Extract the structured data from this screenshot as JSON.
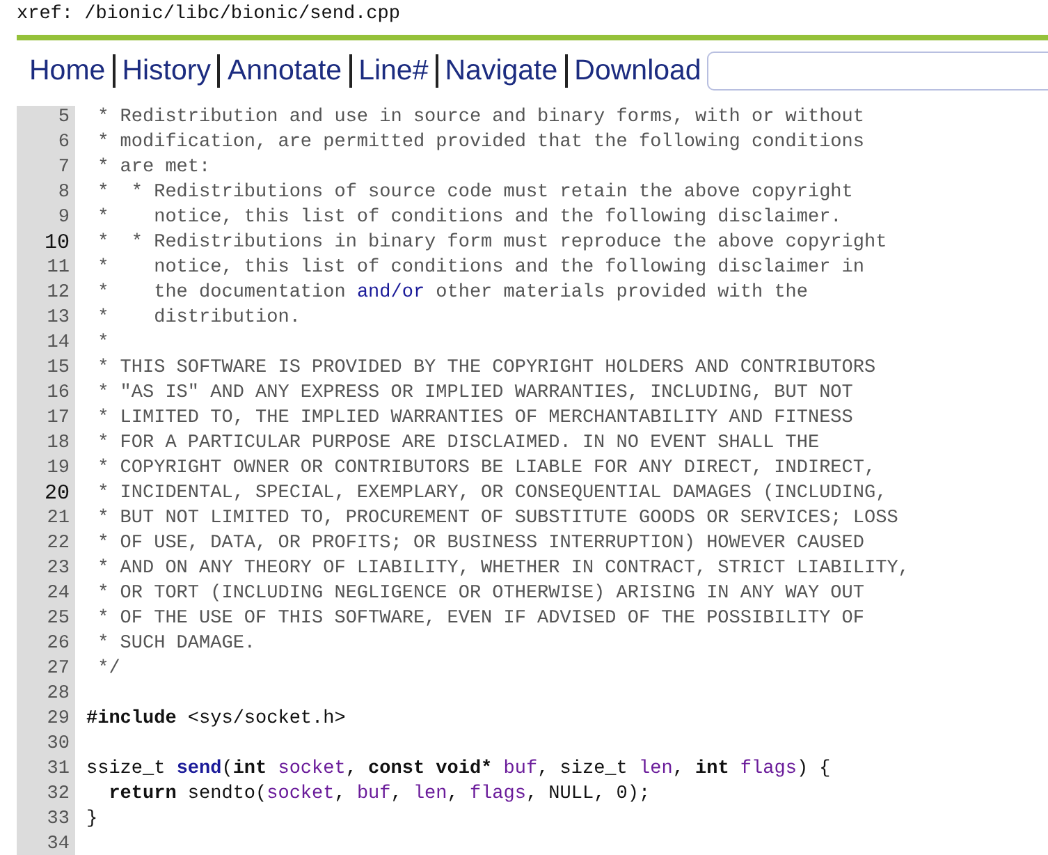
{
  "title": "xref: /bionic/libc/bionic/send.cpp",
  "nav": [
    {
      "label": "Home"
    },
    {
      "label": "History"
    },
    {
      "label": "Annotate"
    },
    {
      "label": "Line#"
    },
    {
      "label": "Navigate"
    },
    {
      "label": "Download"
    }
  ],
  "lines": [
    {
      "number": "5",
      "bold": false,
      "tokens": [
        {
          "kind": "comment",
          "text": " * Redistribution and use in source and binary forms, with or without"
        }
      ]
    },
    {
      "number": "6",
      "bold": false,
      "tokens": [
        {
          "kind": "comment",
          "text": " * modification, are permitted provided that the following conditions"
        }
      ]
    },
    {
      "number": "7",
      "bold": false,
      "tokens": [
        {
          "kind": "comment",
          "text": " * are met:"
        }
      ]
    },
    {
      "number": "8",
      "bold": false,
      "tokens": [
        {
          "kind": "comment",
          "text": " *  * Redistributions of source code must retain the above copyright"
        }
      ]
    },
    {
      "number": "9",
      "bold": false,
      "tokens": [
        {
          "kind": "comment",
          "text": " *    notice, this list of conditions and the following disclaimer."
        }
      ]
    },
    {
      "number": "10",
      "bold": true,
      "tokens": [
        {
          "kind": "comment",
          "text": " *  * Redistributions in binary form must reproduce the above copyright"
        }
      ]
    },
    {
      "number": "11",
      "bold": false,
      "tokens": [
        {
          "kind": "comment",
          "text": " *    notice, this list of conditions and the following disclaimer in"
        }
      ]
    },
    {
      "number": "12",
      "bold": false,
      "tokens": [
        {
          "kind": "comment",
          "text": " *    the documentation "
        },
        {
          "kind": "link",
          "text": "and/or"
        },
        {
          "kind": "comment",
          "text": " other materials provided with the"
        }
      ]
    },
    {
      "number": "13",
      "bold": false,
      "tokens": [
        {
          "kind": "comment",
          "text": " *    distribution."
        }
      ]
    },
    {
      "number": "14",
      "bold": false,
      "tokens": [
        {
          "kind": "comment",
          "text": " *"
        }
      ]
    },
    {
      "number": "15",
      "bold": false,
      "tokens": [
        {
          "kind": "comment",
          "text": " * THIS SOFTWARE IS PROVIDED BY THE COPYRIGHT HOLDERS AND CONTRIBUTORS"
        }
      ]
    },
    {
      "number": "16",
      "bold": false,
      "tokens": [
        {
          "kind": "comment",
          "text": " * \"AS IS\" AND ANY EXPRESS OR IMPLIED WARRANTIES, INCLUDING, BUT NOT"
        }
      ]
    },
    {
      "number": "17",
      "bold": false,
      "tokens": [
        {
          "kind": "comment",
          "text": " * LIMITED TO, THE IMPLIED WARRANTIES OF MERCHANTABILITY AND FITNESS"
        }
      ]
    },
    {
      "number": "18",
      "bold": false,
      "tokens": [
        {
          "kind": "comment",
          "text": " * FOR A PARTICULAR PURPOSE ARE DISCLAIMED. IN NO EVENT SHALL THE"
        }
      ]
    },
    {
      "number": "19",
      "bold": false,
      "tokens": [
        {
          "kind": "comment",
          "text": " * COPYRIGHT OWNER OR CONTRIBUTORS BE LIABLE FOR ANY DIRECT, INDIRECT,"
        }
      ]
    },
    {
      "number": "20",
      "bold": true,
      "tokens": [
        {
          "kind": "comment",
          "text": " * INCIDENTAL, SPECIAL, EXEMPLARY, OR CONSEQUENTIAL DAMAGES (INCLUDING,"
        }
      ]
    },
    {
      "number": "21",
      "bold": false,
      "tokens": [
        {
          "kind": "comment",
          "text": " * BUT NOT LIMITED TO, PROCUREMENT OF SUBSTITUTE GOODS OR SERVICES; LOSS"
        }
      ]
    },
    {
      "number": "22",
      "bold": false,
      "tokens": [
        {
          "kind": "comment",
          "text": " * OF USE, DATA, OR PROFITS; OR BUSINESS INTERRUPTION) HOWEVER CAUSED"
        }
      ]
    },
    {
      "number": "23",
      "bold": false,
      "tokens": [
        {
          "kind": "comment",
          "text": " * AND ON ANY THEORY OF LIABILITY, WHETHER IN CONTRACT, STRICT LIABILITY,"
        }
      ]
    },
    {
      "number": "24",
      "bold": false,
      "tokens": [
        {
          "kind": "comment",
          "text": " * OR TORT (INCLUDING NEGLIGENCE OR OTHERWISE) ARISING IN ANY WAY OUT"
        }
      ]
    },
    {
      "number": "25",
      "bold": false,
      "tokens": [
        {
          "kind": "comment",
          "text": " * OF THE USE OF THIS SOFTWARE, EVEN IF ADVISED OF THE POSSIBILITY OF"
        }
      ]
    },
    {
      "number": "26",
      "bold": false,
      "tokens": [
        {
          "kind": "comment",
          "text": " * SUCH DAMAGE."
        }
      ]
    },
    {
      "number": "27",
      "bold": false,
      "tokens": [
        {
          "kind": "comment",
          "text": " */"
        }
      ]
    },
    {
      "number": "28",
      "bold": false
    },
    {
      "number": "29",
      "bold": false,
      "tokens": [
        {
          "kind": "keyword",
          "text": "#include"
        },
        {
          "kind": "plain",
          "text": " <sys/socket.h>"
        }
      ]
    },
    {
      "number": "30",
      "bold": false
    },
    {
      "number": "31",
      "bold": false,
      "tokens": [
        {
          "kind": "plain",
          "text": "ssize_t "
        },
        {
          "kind": "function",
          "text": "send"
        },
        {
          "kind": "plain",
          "text": "("
        },
        {
          "kind": "keyword",
          "text": "int "
        },
        {
          "kind": "param",
          "text": "socket"
        },
        {
          "kind": "plain",
          "text": ", "
        },
        {
          "kind": "keyword",
          "text": "const void* "
        },
        {
          "kind": "param",
          "text": "buf"
        },
        {
          "kind": "plain",
          "text": ", size_t "
        },
        {
          "kind": "param",
          "text": "len"
        },
        {
          "kind": "plain",
          "text": ", "
        },
        {
          "kind": "keyword",
          "text": "int "
        },
        {
          "kind": "param",
          "text": "flags"
        },
        {
          "kind": "plain",
          "text": ") {"
        }
      ]
    },
    {
      "number": "32",
      "bold": false,
      "tokens": [
        {
          "kind": "keyword",
          "text": "  return"
        },
        {
          "kind": "plain",
          "text": " sendto("
        },
        {
          "kind": "param",
          "text": "socket"
        },
        {
          "kind": "plain",
          "text": ", "
        },
        {
          "kind": "param",
          "text": "buf"
        },
        {
          "kind": "plain",
          "text": ", "
        },
        {
          "kind": "param",
          "text": "len"
        },
        {
          "kind": "plain",
          "text": ", "
        },
        {
          "kind": "param",
          "text": "flags"
        },
        {
          "kind": "plain",
          "text": ", NULL, 0);"
        }
      ]
    },
    {
      "number": "33",
      "bold": false,
      "tokens": [
        {
          "kind": "plain",
          "text": "}"
        }
      ]
    },
    {
      "number": "34",
      "bold": false
    }
  ]
}
